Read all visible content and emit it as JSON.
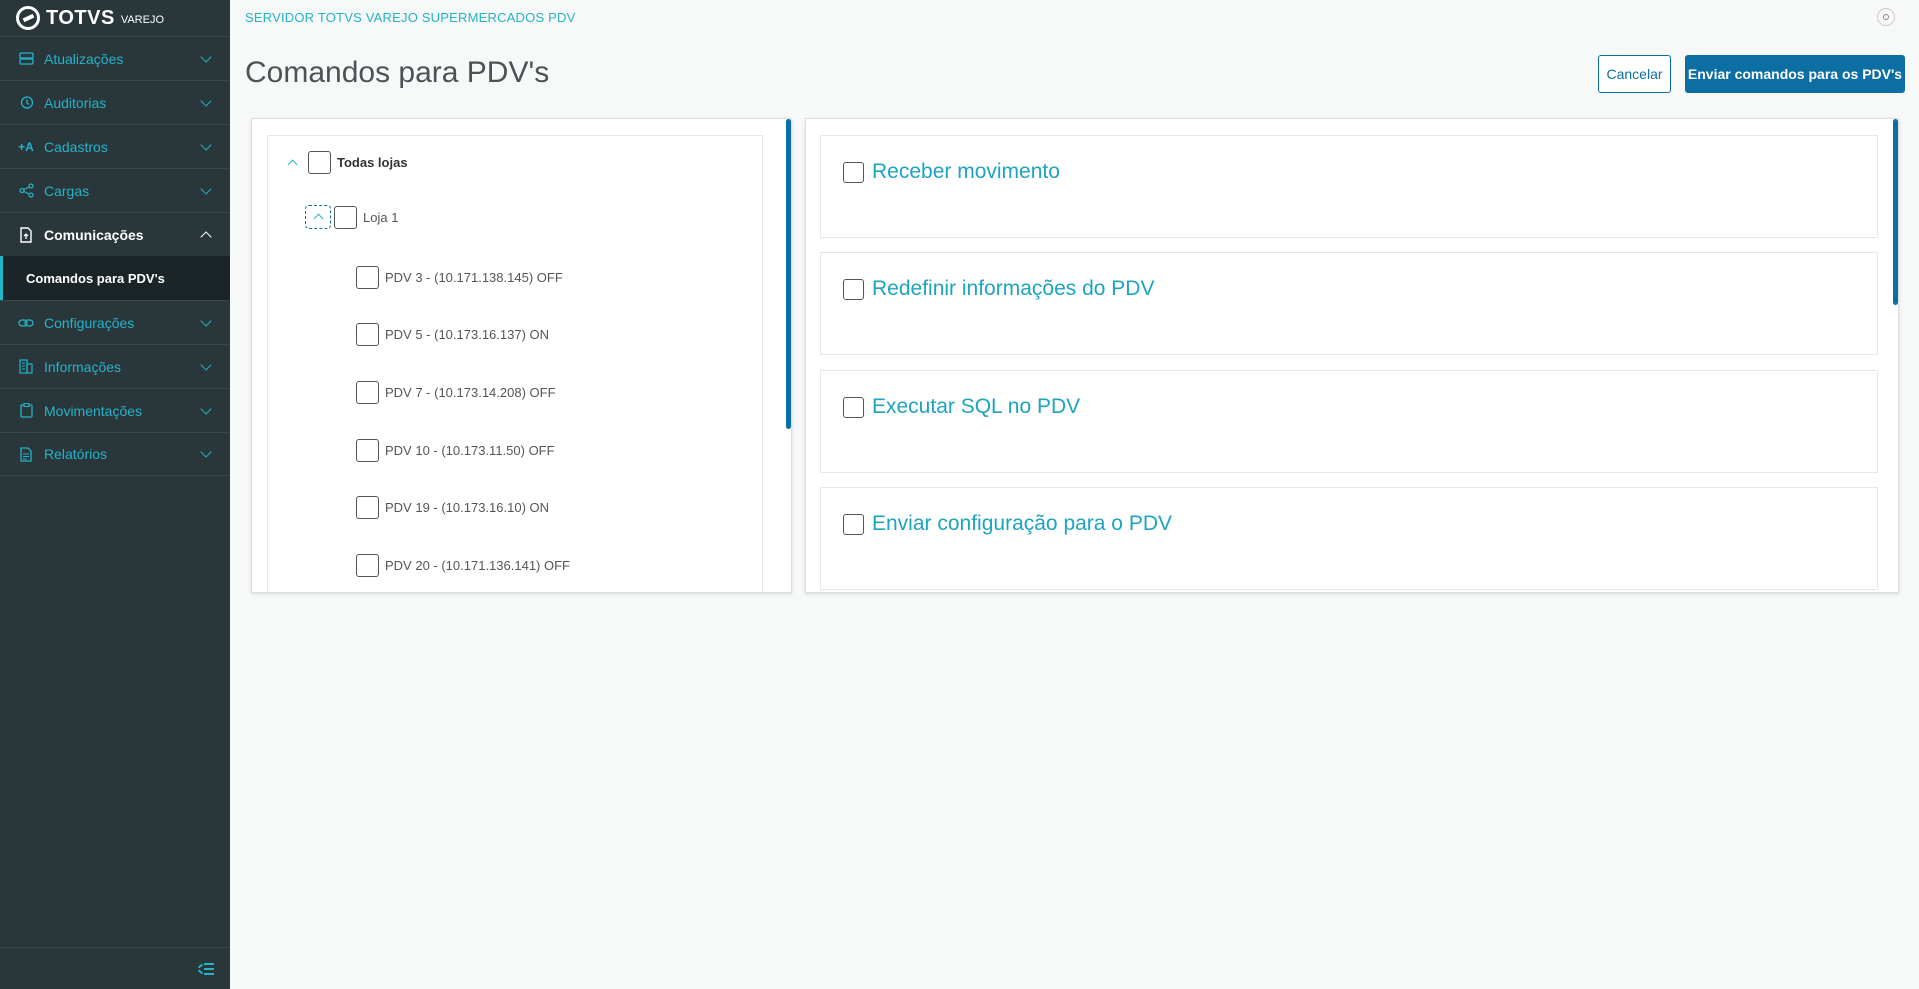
{
  "brand": {
    "name": "TOTVS",
    "sub": "VAREJO"
  },
  "sidebar": {
    "items": [
      {
        "label": "Atualizações",
        "icon": "server-icon"
      },
      {
        "label": "Auditorias",
        "icon": "history-icon"
      },
      {
        "label": "Cadastros",
        "icon": "add-text-icon"
      },
      {
        "label": "Cargas",
        "icon": "share-icon"
      },
      {
        "label": "Comunicações",
        "icon": "document-sync-icon"
      },
      {
        "label": "Configurações",
        "icon": "link-icon"
      },
      {
        "label": "Informações",
        "icon": "building-icon"
      },
      {
        "label": "Movimentações",
        "icon": "clipboard-icon"
      },
      {
        "label": "Relatórios",
        "icon": "report-icon"
      }
    ],
    "open_item": "Comunicações",
    "subitems": [
      {
        "label": "Comandos para PDV's",
        "active": true
      }
    ]
  },
  "header": {
    "server": "SERVIDOR TOTVS VAREJO SUPERMERCADOS PDV",
    "title": "Comandos para PDV's",
    "cancel_label": "Cancelar",
    "send_label": "Enviar comandos para os PDV's"
  },
  "tree": {
    "root": "Todas lojas",
    "store": "Loja 1",
    "pdvs": [
      "PDV 3 - (10.171.138.145) OFF",
      "PDV 5 - (10.173.16.137) ON",
      "PDV 7 - (10.173.14.208) OFF",
      "PDV 10 - (10.173.11.50) OFF",
      "PDV 19 - (10.173.16.10) ON",
      "PDV 20 - (10.171.136.141) OFF"
    ]
  },
  "commands": [
    "Receber movimento",
    "Redefinir informações do PDV",
    "Executar SQL no PDV",
    "Enviar configuração para o PDV"
  ],
  "colors": {
    "sidebar": "#29363a",
    "accent": "#25b3c9",
    "primary": "#0c6ea3"
  }
}
